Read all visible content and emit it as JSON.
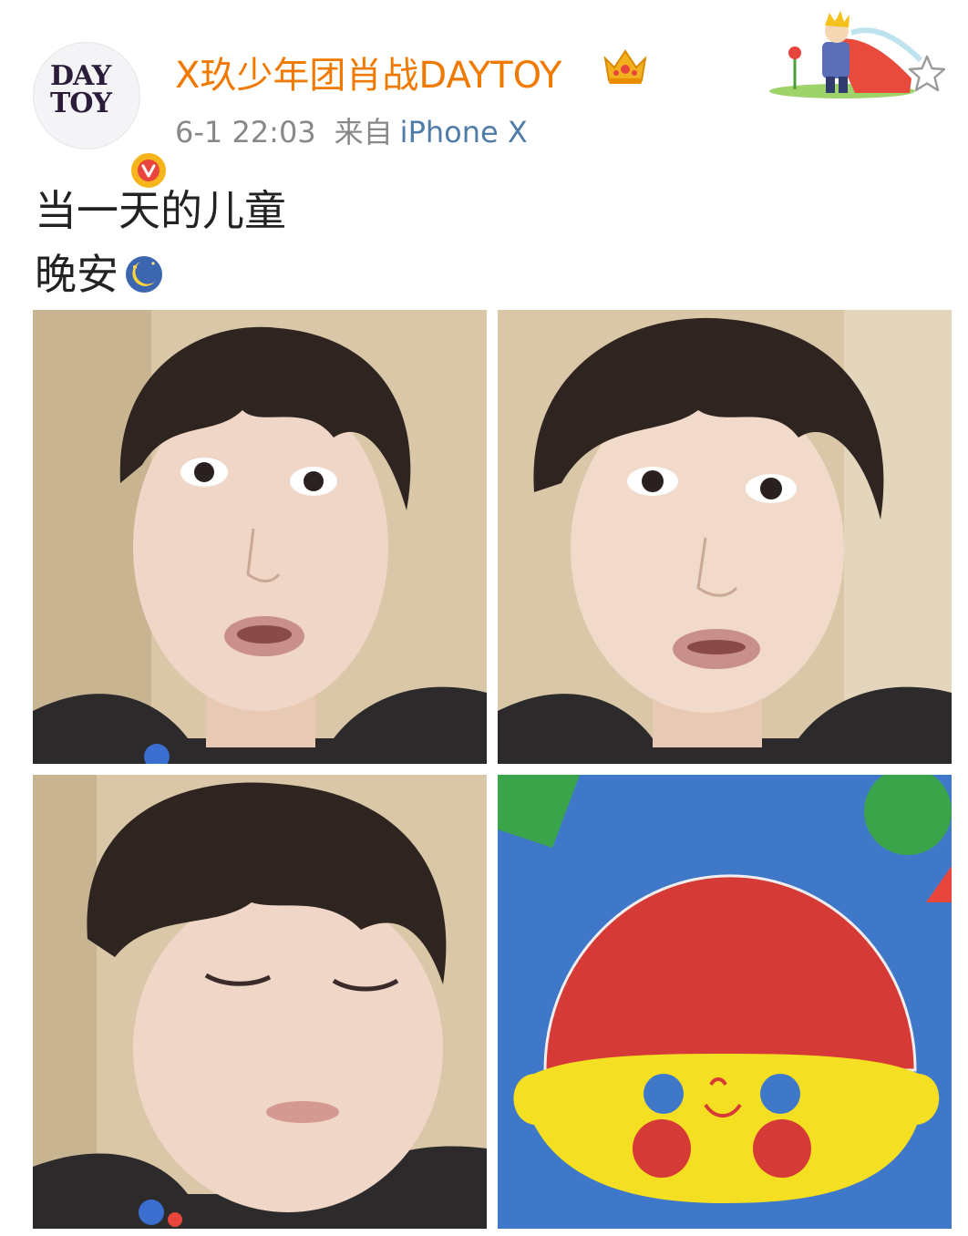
{
  "post": {
    "username": "X玖少年团肖战DAYTOY",
    "avatar_text_line1": "DAY",
    "avatar_text_line2": "TOY",
    "timestamp": "6-1 22:03",
    "source_label": "来自",
    "device": "iPhone X",
    "text_line1": "当一天的儿童",
    "text_line2": "晚安"
  },
  "icons": {
    "verified": "verified-v-icon",
    "crown": "crown-icon",
    "favorite": "star-outline-icon",
    "emoji": "moon-emoji-icon",
    "decoration": "little-prince-decoration"
  },
  "colors": {
    "username": "#f07a00",
    "meta": "#888888",
    "device": "#4f7ca8",
    "text": "#222222"
  },
  "images": [
    {
      "name": "selfie-1"
    },
    {
      "name": "selfie-2"
    },
    {
      "name": "selfie-3"
    },
    {
      "name": "cartoon-face"
    }
  ]
}
